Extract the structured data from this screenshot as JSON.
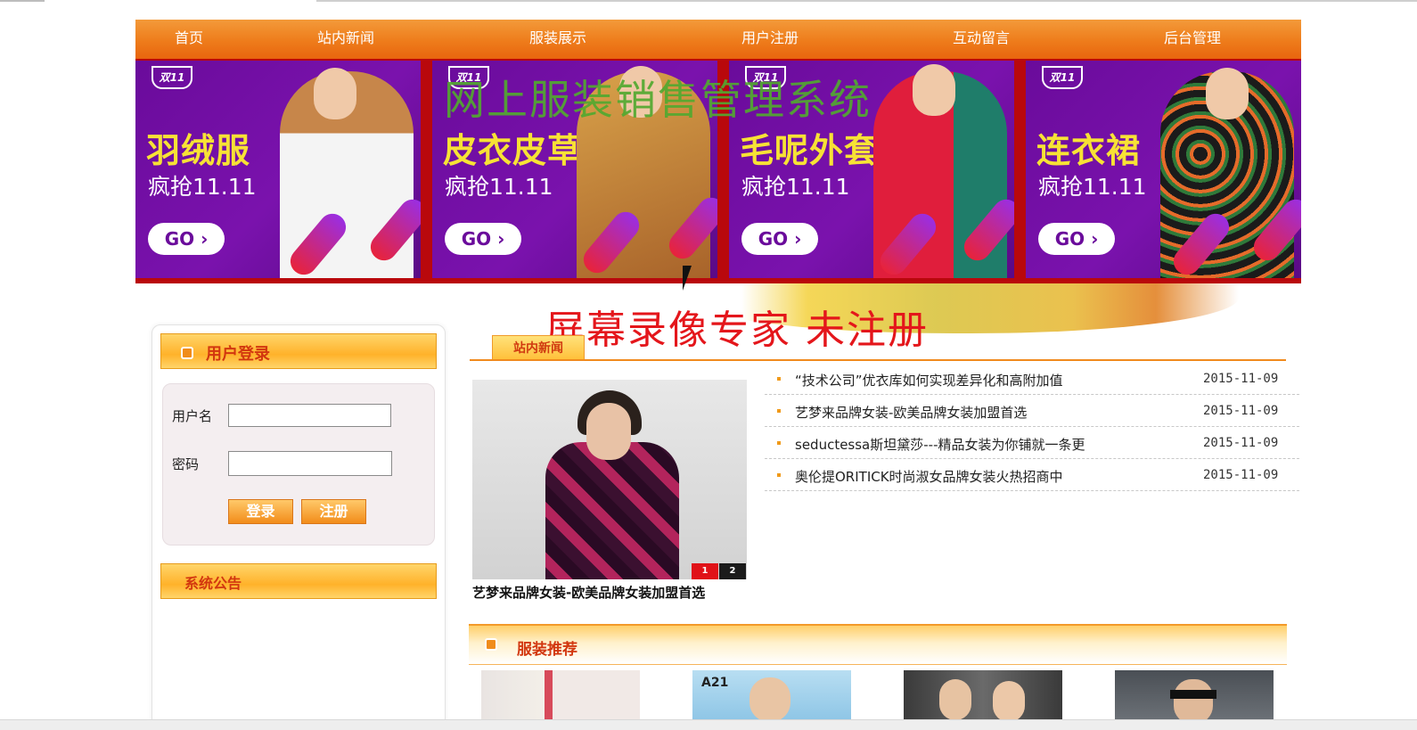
{
  "nav": {
    "items": [
      "首页",
      "站内新闻",
      "服装展示",
      "用户注册",
      "互动留言",
      "后台管理"
    ]
  },
  "banner": {
    "site_title": "网上服装销售管理系统",
    "panels": [
      {
        "brand": "双11",
        "title": "羽绒服",
        "subtitle": "疯抢11.11",
        "go": "GO ›"
      },
      {
        "brand": "双11",
        "title": "皮衣皮草",
        "subtitle": "疯抢11.11",
        "go": "GO ›"
      },
      {
        "brand": "双11",
        "title": "毛呢外套",
        "subtitle": "疯抢11.11",
        "go": "GO ›"
      },
      {
        "brand": "双11",
        "title": "连衣裙",
        "subtitle": "疯抢11.11",
        "go": "GO ›"
      }
    ]
  },
  "watermark": "屏幕录像专家  未注册",
  "login": {
    "title": "用户登录",
    "username_label": "用户名",
    "password_label": "密码",
    "username_value": "",
    "password_value": "",
    "login_button": "登录",
    "register_button": "注册"
  },
  "announcement": {
    "title": "系统公告"
  },
  "news": {
    "tab_label": "站内新闻",
    "caption": "艺梦来品牌女装-欧美品牌女装加盟首选",
    "pager": [
      "1",
      "2"
    ],
    "items": [
      {
        "title": "“技术公司”优衣库如何实现差异化和高附加值",
        "date": "2015-11-09"
      },
      {
        "title": "艺梦来品牌女装-欧美品牌女装加盟首选",
        "date": "2015-11-09"
      },
      {
        "title": "seductessa斯坦黛莎---精品女装为你铺就一条更",
        "date": "2015-11-09"
      },
      {
        "title": "奥伦提ORITICK时尚淑女品牌女装火热招商中",
        "date": "2015-11-09"
      }
    ]
  },
  "recommend": {
    "title": "服装推荐",
    "thumbs": [
      {
        "label": ""
      },
      {
        "label": "A21"
      },
      {
        "label": ""
      },
      {
        "label": ""
      }
    ]
  },
  "colors": {
    "nav_orange": "#ee7c1b",
    "banner_purple": "#6a0b9b",
    "banner_red": "#b9080c",
    "title_green": "#52a930",
    "watermark_red": "#e4161b",
    "heading_red": "#d2370f"
  }
}
